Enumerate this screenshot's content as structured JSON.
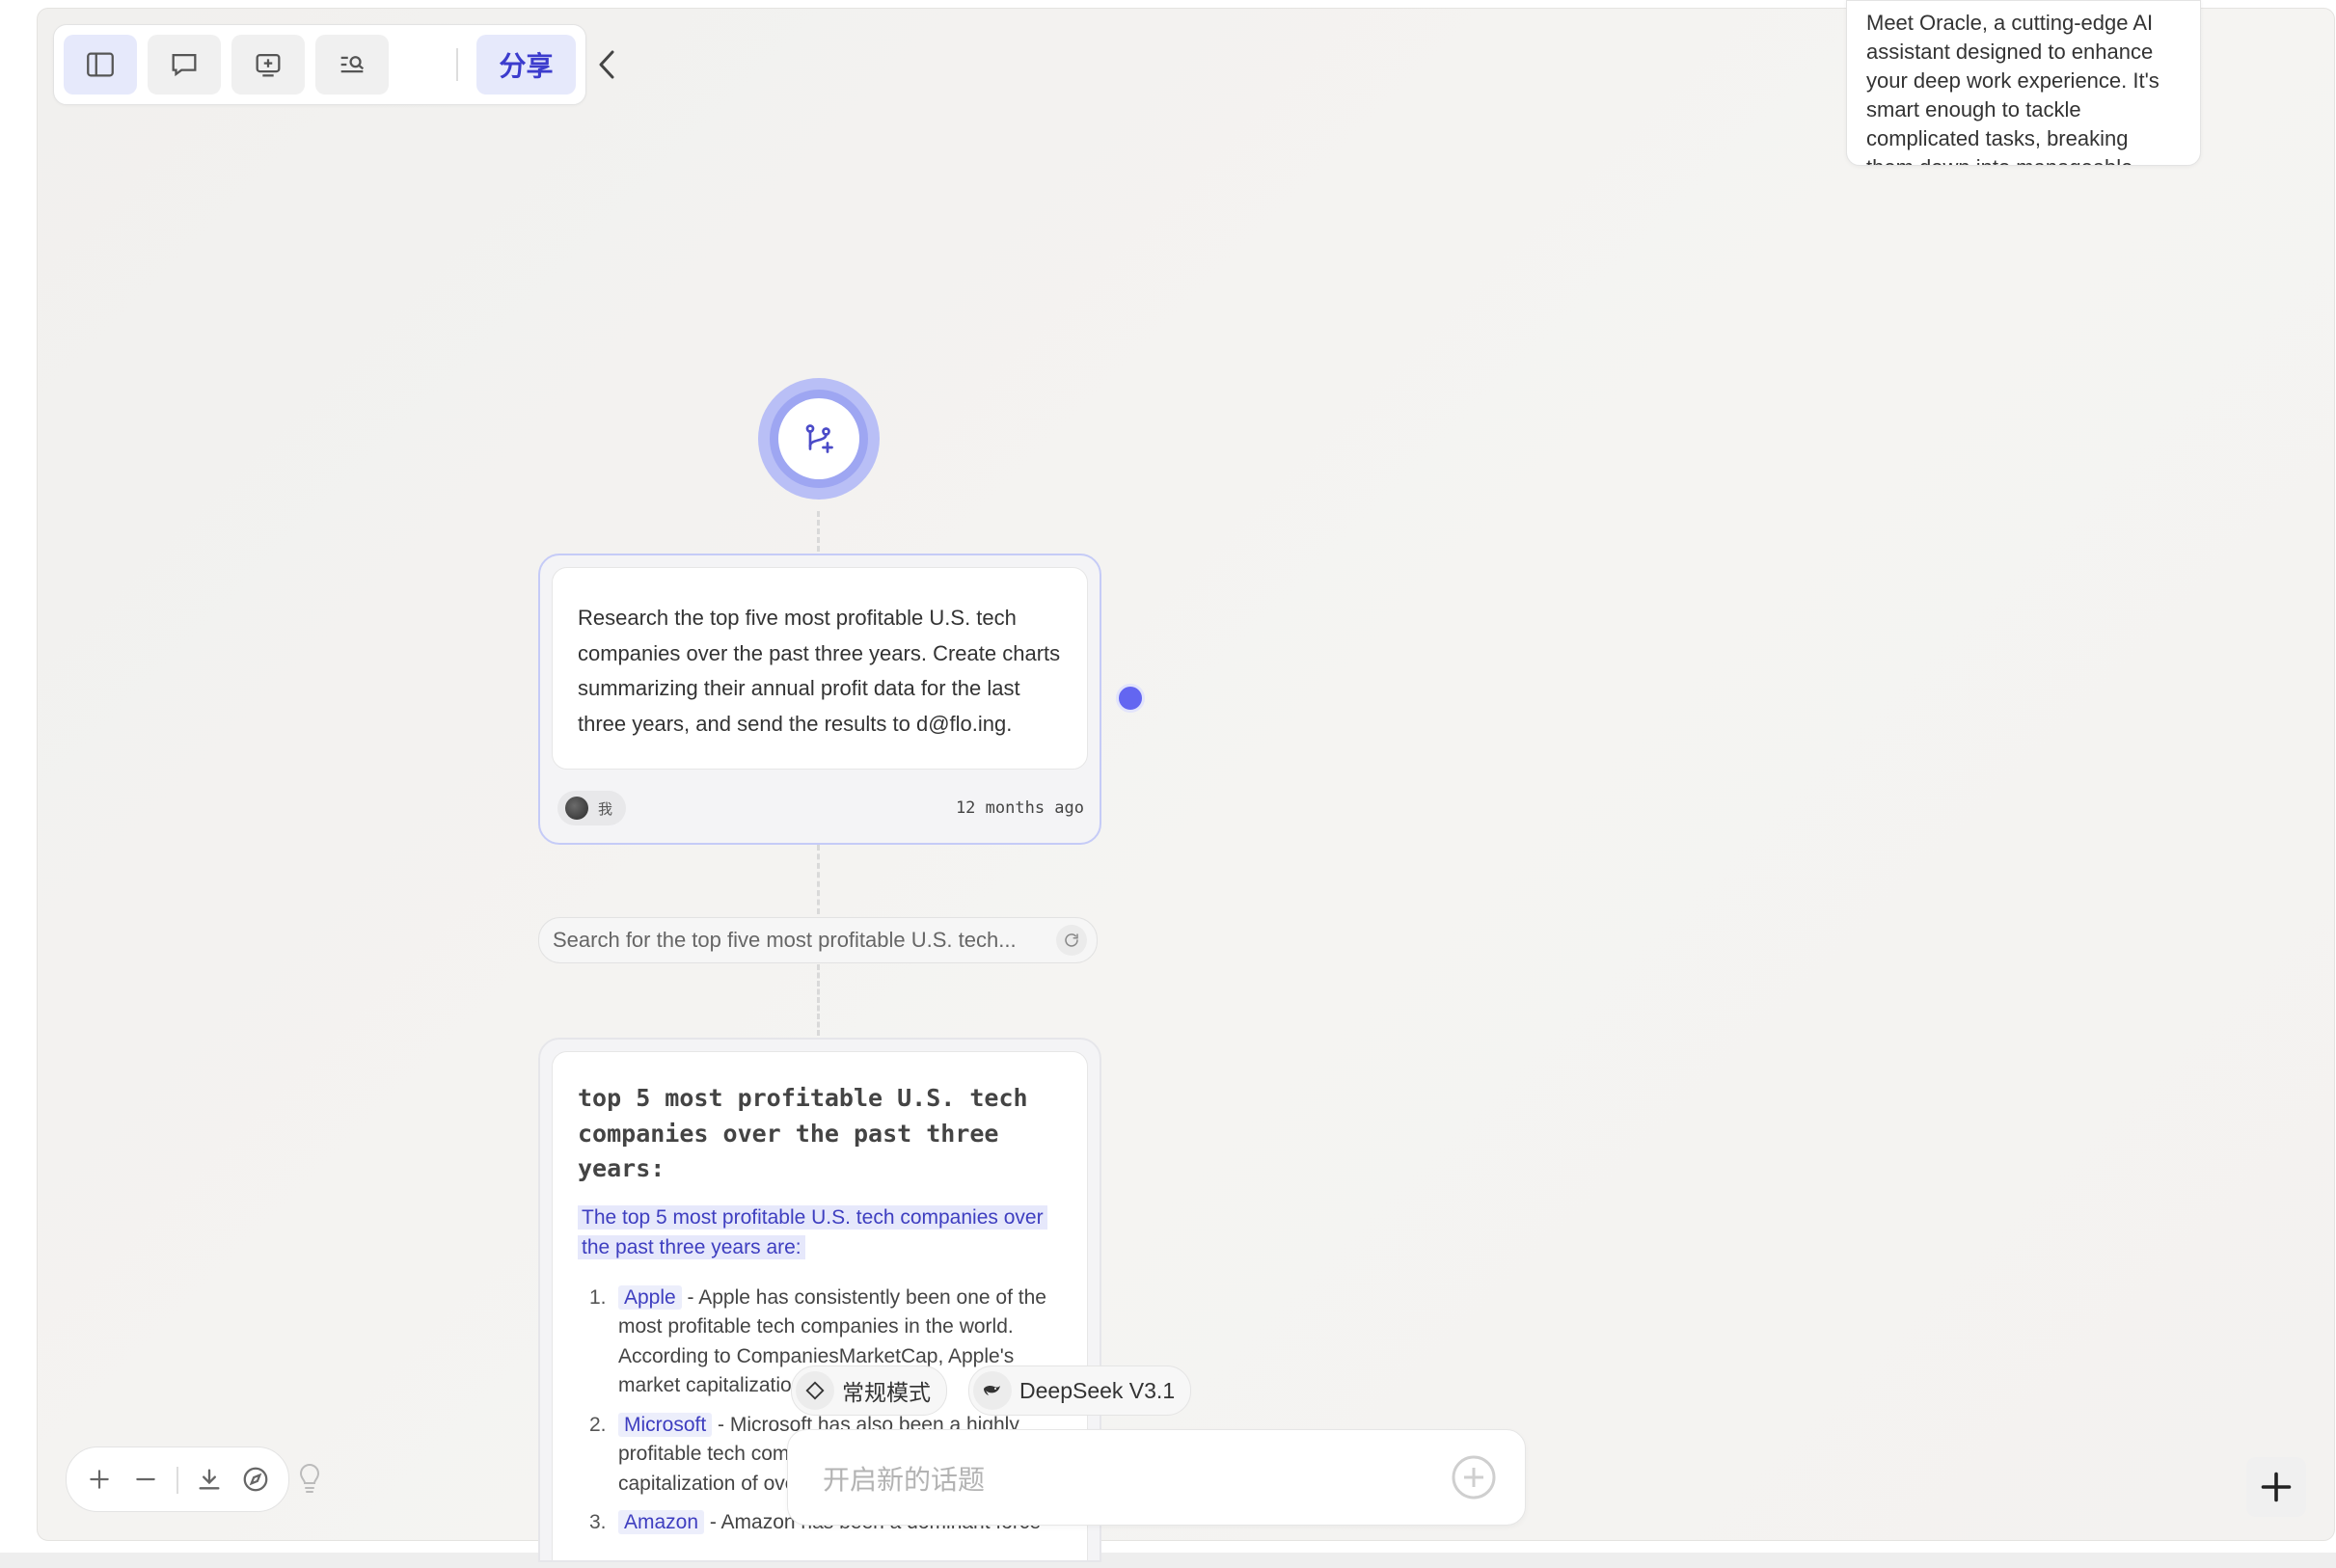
{
  "toolbar": {
    "buttons": [
      {
        "icon": "sidebar-icon"
      },
      {
        "icon": "chat-bubble-icon"
      },
      {
        "icon": "add-slide-icon"
      },
      {
        "icon": "search-list-icon"
      }
    ],
    "share_label": "分享",
    "collapse_icon": "chevron-left-icon"
  },
  "preview": {
    "text": "Meet Oracle, a cutting-edge AI assistant designed to enhance your deep work experience. It's smart enough to tackle complicated tasks, breaking them down into manageable"
  },
  "start_node": {
    "icon": "branch-add-icon",
    "accent": "#6366f1"
  },
  "question": {
    "text": "Research the top five most profitable U.S. tech companies over the past three years. Create charts summarizing their annual profit data for the last three years, and send the results to d@flo.ing.",
    "user_label": "我",
    "timestamp": "12 months ago"
  },
  "search_step": {
    "text": "Search for the top five most profitable U.S. tech..."
  },
  "answer": {
    "title": "top 5 most profitable U.S. tech companies over the past three years:",
    "intro": "The top 5 most profitable U.S. tech companies over the past three years are:",
    "items": [
      {
        "num": "1.",
        "company": "Apple",
        "text": " - Apple has consistently been one of the most profitable tech companies in the world. According to CompaniesMarketCap, Apple's market capitalization..."
      },
      {
        "num": "2.",
        "company": "Microsoft",
        "text": " - Microsoft has also been a highly profitable tech company, with a market capitalization of over..."
      },
      {
        "num": "3.",
        "company": "Amazon",
        "text": " - Amazon has been a dominant force"
      }
    ]
  },
  "composer": {
    "mode_label": "常规模式",
    "model_label": "DeepSeek V3.1",
    "placeholder": "开启新的话题"
  },
  "zoom_controls": {
    "icons": [
      "zoom-in-icon",
      "zoom-out-icon",
      "download-icon",
      "compass-icon",
      "lightbulb-icon"
    ]
  },
  "colors": {
    "accent": "#6366f1",
    "highlight_bg": "#e6e8fb",
    "highlight_text": "#3e3ec0"
  }
}
